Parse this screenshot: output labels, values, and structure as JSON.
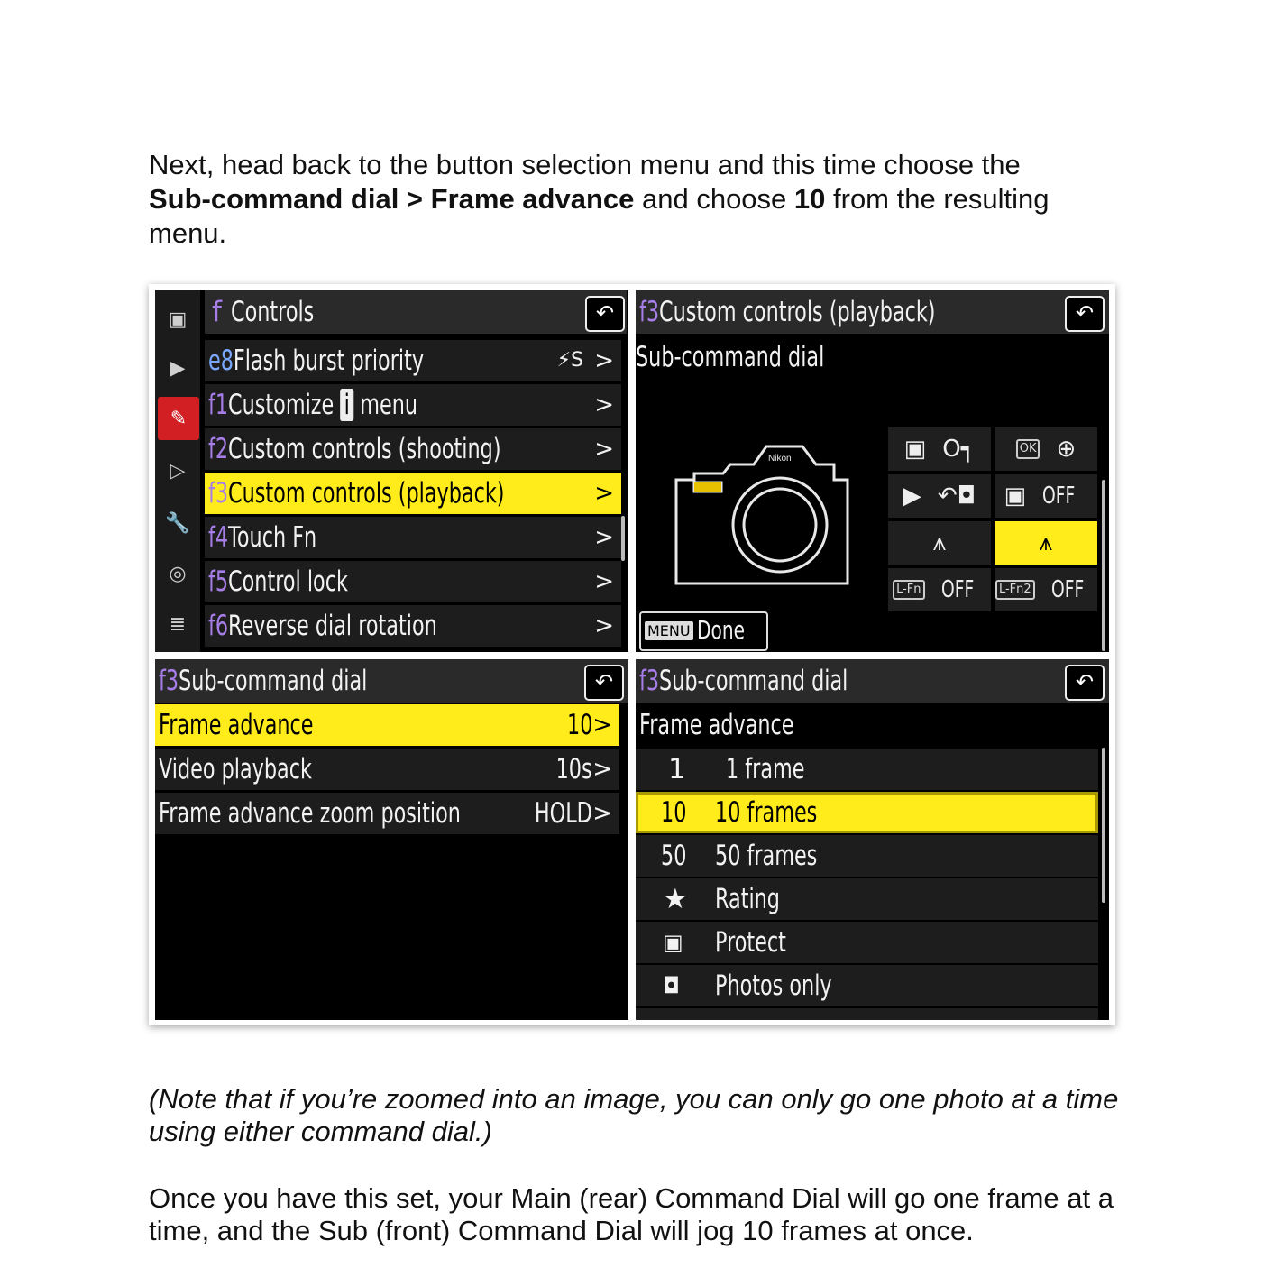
{
  "intro": {
    "line_start": "Next, head back to the button selection menu and this time choose the",
    "bold_path": "Sub-command dial > Frame advance",
    "mid": " and choose ",
    "bold_value": "10",
    "end": " from the resulting menu."
  },
  "screen_controls": {
    "title_letter": "f",
    "title": "Controls",
    "back_icon": "return-icon",
    "side_icons": [
      "camera-icon",
      "movie-icon",
      "pencil-icon",
      "playback-icon",
      "wrench-icon",
      "network-icon",
      "my-menu-icon"
    ],
    "items": [
      {
        "tag": "e8",
        "label": "Flash burst priority",
        "value": "⚡S",
        "arrow": ">"
      },
      {
        "tag": "f1",
        "label": "Customize",
        "label_icon": "i",
        "label_end": "menu",
        "arrow": ">"
      },
      {
        "tag": "f2",
        "label": "Custom controls (shooting)",
        "arrow": ">"
      },
      {
        "tag": "f3",
        "label": "Custom controls (playback)",
        "arrow": ">"
      },
      {
        "tag": "f4",
        "label": "Touch Fn",
        "arrow": ">"
      },
      {
        "tag": "f5",
        "label": "Control lock",
        "arrow": ">"
      },
      {
        "tag": "f6",
        "label": "Reverse dial rotation",
        "arrow": ">"
      }
    ]
  },
  "screen_custom": {
    "tag": "f3",
    "title": "Custom controls (playback)",
    "subtitle": "Sub-command dial",
    "camera_brand": "Nikon",
    "grid": [
      {
        "left": "▣",
        "right": "O┑"
      },
      {
        "left": "OK",
        "right": "⊕"
      },
      {
        "left": "▶",
        "right": "↶◘"
      },
      {
        "left": "▣",
        "right": "OFF"
      },
      {
        "left": "⩚",
        "right": ""
      },
      {
        "left": "⩚",
        "right": ""
      },
      {
        "left": "L-Fn",
        "right": "OFF"
      },
      {
        "left": "L-Fn2",
        "right": "OFF"
      }
    ],
    "menu_label": "MENU",
    "done_label": "Done"
  },
  "screen_subcmd": {
    "tag": "f3",
    "title": "Sub-command dial",
    "items": [
      {
        "label": "Frame advance",
        "value": "10",
        "arrow": ">"
      },
      {
        "label": "Video playback",
        "value": "10s",
        "arrow": ">"
      },
      {
        "label": "Frame advance zoom position",
        "value": "HOLD",
        "arrow": ">"
      }
    ]
  },
  "screen_frame": {
    "tag": "f3",
    "title": "Sub-command dial",
    "subtitle": "Frame advance",
    "options": [
      {
        "code": "1",
        "label": "1 frame"
      },
      {
        "code": "10",
        "label": "10 frames"
      },
      {
        "code": "50",
        "label": "50 frames"
      },
      {
        "code": "★",
        "label": "Rating"
      },
      {
        "code": "▣",
        "label": "Protect"
      },
      {
        "code": "◘",
        "label": "Photos only"
      }
    ]
  },
  "note": "(Note that if you’re zoomed into an image, you can only go one photo at a time using either command dial.)",
  "closing": "Once you have this set, your Main (rear) Command Dial will go one frame at a time, and the Sub (front) Command Dial will jog 10 frames at once."
}
